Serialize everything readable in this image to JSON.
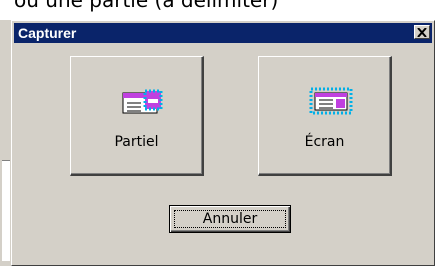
{
  "background": {
    "text": "ou une partie (à délimiter)"
  },
  "dialog": {
    "title": "Capturer",
    "close_symbol": "×",
    "buttons": {
      "partial": {
        "label": "Partiel",
        "icon": "partial-capture-icon"
      },
      "screen": {
        "label": "Écran",
        "icon": "screen-capture-icon"
      },
      "cancel": {
        "label": "Annuler"
      }
    }
  },
  "colors": {
    "titlebar": "#0a246a",
    "dialog_face": "#d4d0c8",
    "icon_magenta": "#c040e0",
    "icon_cyan": "#00b0e8"
  }
}
